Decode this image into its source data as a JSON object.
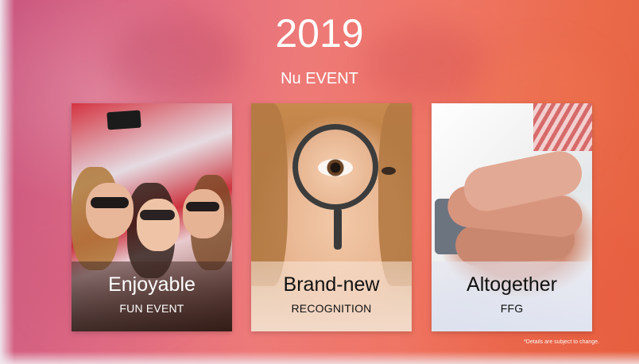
{
  "slide": {
    "year": "2019",
    "event_name": "Nu EVENT",
    "disclaimer": "*Details are subject to change.",
    "colors": {
      "background_start": "#c9567f",
      "background_mid": "#ee7a78",
      "background_end": "#e6623f",
      "title_text": "#ffffff"
    }
  },
  "cards": [
    {
      "image_subject": "group of friends taking a selfie",
      "title": "Enjoyable",
      "subtitle": "FUN EVENT",
      "caption_style": "dark"
    },
    {
      "image_subject": "girl looking through a magnifying glass",
      "title": "Brand-new",
      "subtitle": "RECOGNITION",
      "caption_style": "light"
    },
    {
      "image_subject": "stacked hands teamwork",
      "title": "Altogether",
      "subtitle": "FFG",
      "caption_style": "light"
    }
  ]
}
